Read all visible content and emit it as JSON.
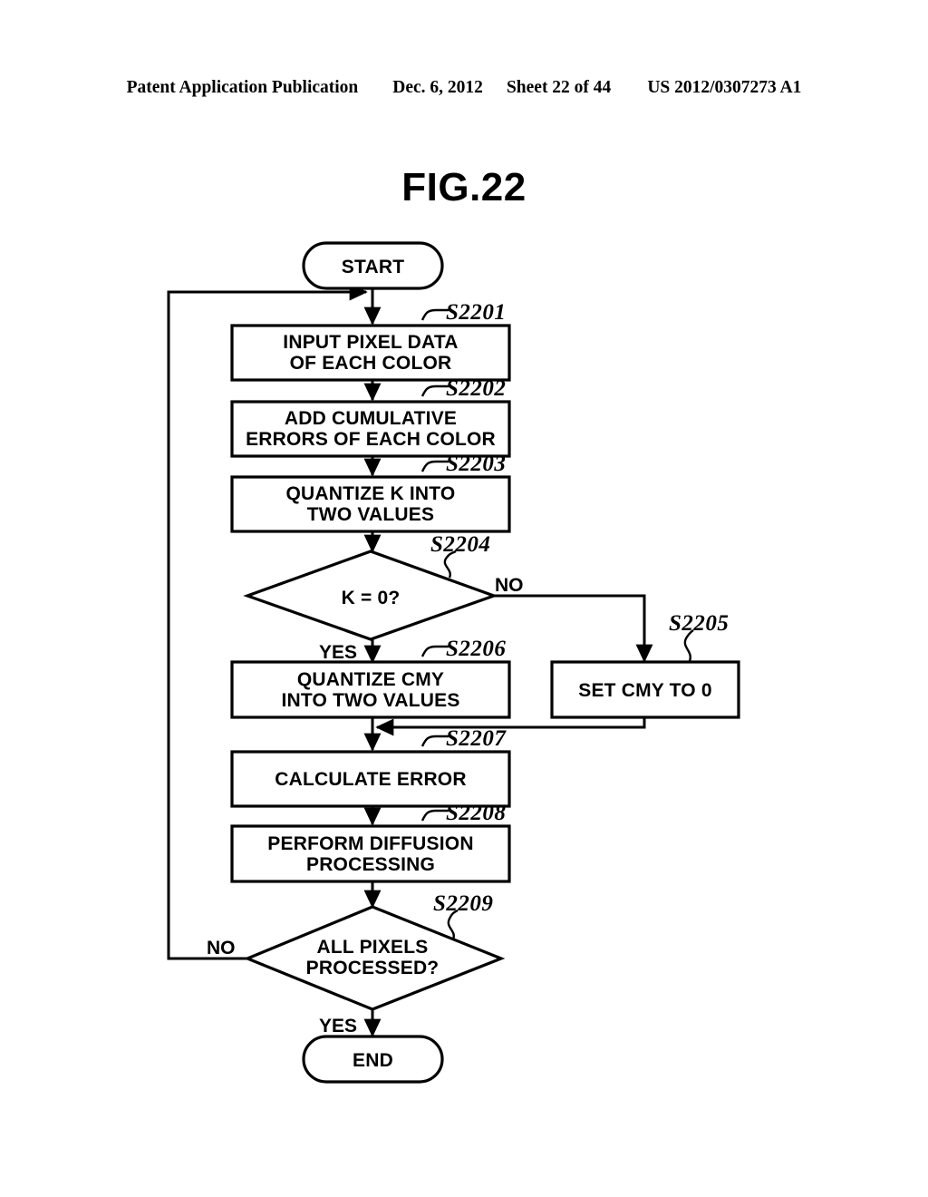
{
  "header": {
    "publication": "Patent Application Publication",
    "date": "Dec. 6, 2012",
    "sheet": "Sheet 22 of 44",
    "number": "US 2012/0307273 A1"
  },
  "figure": {
    "title": "FIG.22"
  },
  "chart_data": {
    "type": "diagram",
    "diagram_kind": "flowchart",
    "title": "FIG.22",
    "nodes": [
      {
        "id": "start",
        "shape": "terminator",
        "text": "START",
        "step": null
      },
      {
        "id": "s2201",
        "shape": "process",
        "text": "INPUT PIXEL DATA\nOF EACH COLOR",
        "step": "S2201"
      },
      {
        "id": "s2202",
        "shape": "process",
        "text": "ADD CUMULATIVE\nERRORS OF EACH COLOR",
        "step": "S2202"
      },
      {
        "id": "s2203",
        "shape": "process",
        "text": "QUANTIZE K INTO\nTWO VALUES",
        "step": "S2203"
      },
      {
        "id": "s2204",
        "shape": "decision",
        "text": "K = 0?",
        "step": "S2204"
      },
      {
        "id": "s2205",
        "shape": "process",
        "text": "SET CMY TO 0",
        "step": "S2205"
      },
      {
        "id": "s2206",
        "shape": "process",
        "text": "QUANTIZE CMY\nINTO TWO VALUES",
        "step": "S2206"
      },
      {
        "id": "s2207",
        "shape": "process",
        "text": "CALCULATE ERROR",
        "step": "S2207"
      },
      {
        "id": "s2208",
        "shape": "process",
        "text": "PERFORM DIFFUSION\nPROCESSING",
        "step": "S2208"
      },
      {
        "id": "s2209",
        "shape": "decision",
        "text": "ALL PIXELS\nPROCESSED?",
        "step": "S2209"
      },
      {
        "id": "end",
        "shape": "terminator",
        "text": "END",
        "step": null
      }
    ],
    "edges": [
      {
        "from": "start",
        "to": "s2201",
        "label": ""
      },
      {
        "from": "s2201",
        "to": "s2202",
        "label": ""
      },
      {
        "from": "s2202",
        "to": "s2203",
        "label": ""
      },
      {
        "from": "s2203",
        "to": "s2204",
        "label": ""
      },
      {
        "from": "s2204",
        "to": "s2206",
        "label": "YES"
      },
      {
        "from": "s2204",
        "to": "s2205",
        "label": "NO"
      },
      {
        "from": "s2206",
        "to": "s2207",
        "label": ""
      },
      {
        "from": "s2205",
        "to": "s2207",
        "label": ""
      },
      {
        "from": "s2207",
        "to": "s2208",
        "label": ""
      },
      {
        "from": "s2208",
        "to": "s2209",
        "label": ""
      },
      {
        "from": "s2209",
        "to": "end",
        "label": "YES"
      },
      {
        "from": "s2209",
        "to": "s2201",
        "label": "NO"
      }
    ]
  },
  "nodes": {
    "start": {
      "text": "START"
    },
    "s2201": {
      "line1": "INPUT PIXEL DATA",
      "line2": "OF EACH COLOR",
      "step": "S2201"
    },
    "s2202": {
      "line1": "ADD CUMULATIVE",
      "line2": "ERRORS OF EACH COLOR",
      "step": "S2202"
    },
    "s2203": {
      "line1": "QUANTIZE K INTO",
      "line2": "TWO VALUES",
      "step": "S2203"
    },
    "s2204": {
      "line1": "K = 0?",
      "step": "S2204",
      "yes": "YES",
      "no": "NO"
    },
    "s2205": {
      "line1": "SET CMY TO 0",
      "step": "S2205"
    },
    "s2206": {
      "line1": "QUANTIZE CMY",
      "line2": "INTO TWO VALUES",
      "step": "S2206"
    },
    "s2207": {
      "line1": "CALCULATE ERROR",
      "step": "S2207"
    },
    "s2208": {
      "line1": "PERFORM DIFFUSION",
      "line2": "PROCESSING",
      "step": "S2208"
    },
    "s2209": {
      "line1": "ALL PIXELS",
      "line2": "PROCESSED?",
      "step": "S2209",
      "yes": "YES",
      "no": "NO"
    },
    "end": {
      "text": "END"
    }
  },
  "colors": {
    "ink": "#000000",
    "paper": "#ffffff"
  }
}
